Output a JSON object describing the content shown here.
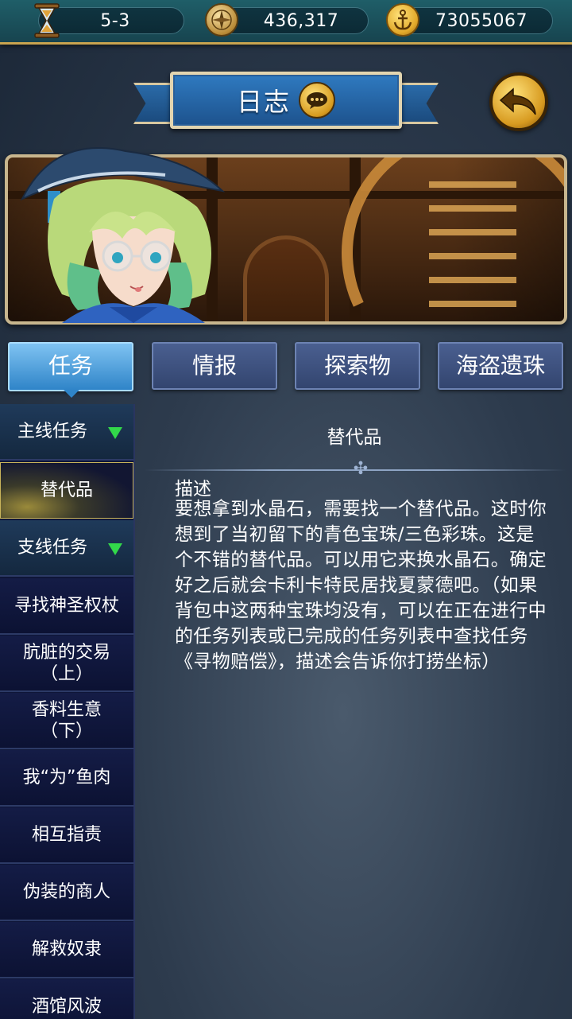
{
  "resources": {
    "stage": "5-3",
    "compass_count": "436,317",
    "gold_count": "73055067"
  },
  "header": {
    "title": "日志"
  },
  "tabs": [
    {
      "label": "任务",
      "active": true
    },
    {
      "label": "情报",
      "active": false
    },
    {
      "label": "探索物",
      "active": false
    },
    {
      "label": "海盗遗珠",
      "active": false
    }
  ],
  "sidebar": {
    "items": [
      {
        "label": "主线任务",
        "type": "category"
      },
      {
        "label": "替代品",
        "type": "selected"
      },
      {
        "label": "支线任务",
        "type": "category"
      },
      {
        "label": "寻找神圣权杖",
        "type": "item"
      },
      {
        "label": "肮脏的交易\n（上）",
        "type": "item"
      },
      {
        "label": "香料生意\n（下）",
        "type": "item"
      },
      {
        "label": "我“为”鱼肉",
        "type": "item"
      },
      {
        "label": "相互指责",
        "type": "item"
      },
      {
        "label": "伪装的商人",
        "type": "item"
      },
      {
        "label": "解救奴隶",
        "type": "item"
      },
      {
        "label": "酒馆风波",
        "type": "item"
      }
    ]
  },
  "quest": {
    "title": "替代品",
    "desc_label": "描述",
    "description": "要想拿到水晶石，需要找一个替代品。这时你想到了当初留下的青色宝珠/三色彩珠。这是个不错的替代品。可以用它来换水晶石。确定好之后就会卡利卡特民居找夏蒙德吧。（如果背包中这两种宝珠均没有，可以在正在进行中的任务列表或已完成的任务列表中查找任务《寻物赔偿》，描述会告诉你打捞坐标）"
  },
  "icons": {
    "stage": "hourglass-icon",
    "compass": "compass-icon",
    "gold": "anchor-coin-icon",
    "chat": "chat-bubble-icon",
    "back": "back-arrow-icon"
  }
}
